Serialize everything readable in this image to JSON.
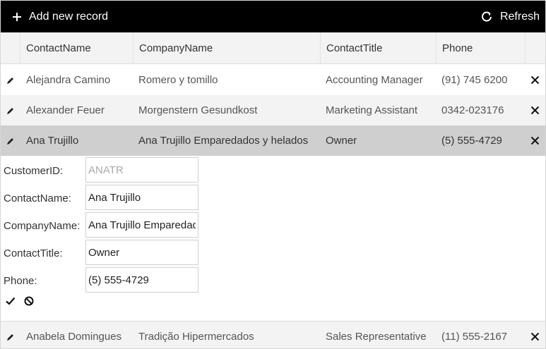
{
  "toolbar": {
    "add_label": "Add new record",
    "refresh_label": "Refresh"
  },
  "columns": [
    "ContactName",
    "CompanyName",
    "ContactTitle",
    "Phone"
  ],
  "rows": [
    {
      "contact_name": "Alejandra Camino",
      "company_name": "Romero y tomillo",
      "contact_title": "Accounting Manager",
      "phone": "(91) 745 6200"
    },
    {
      "contact_name": "Alexander Feuer",
      "company_name": "Morgenstern Gesundkost",
      "contact_title": "Marketing Assistant",
      "phone": "0342-023176"
    },
    {
      "contact_name": "Ana Trujillo",
      "company_name": "Ana Trujillo Emparedados y helados",
      "contact_title": "Owner",
      "phone": "(5) 555-4729"
    },
    {
      "contact_name": "Anabela Domingues",
      "company_name": "Tradição Hipermercados",
      "contact_title": "Sales Representative",
      "phone": "(11) 555-2167"
    }
  ],
  "edit_form": {
    "labels": {
      "customer_id": "CustomerID:",
      "contact_name": "ContactName:",
      "company_name": "CompanyName:",
      "contact_title": "ContactTitle:",
      "phone": "Phone:"
    },
    "values": {
      "customer_id": "ANATR",
      "contact_name": "Ana Trujillo",
      "company_name": "Ana Trujillo Emparedados y helados",
      "contact_title": "Owner",
      "phone": "(5) 555-4729"
    }
  },
  "icons": {
    "add": "plus-icon",
    "refresh": "refresh-icon",
    "edit": "pencil-icon",
    "delete": "close-icon",
    "save": "checkmark-icon",
    "cancel": "cancel-icon"
  }
}
